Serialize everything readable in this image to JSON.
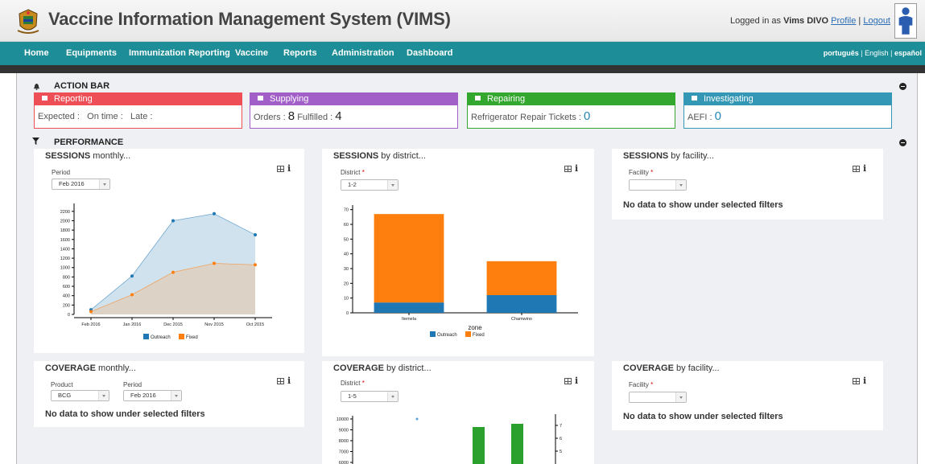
{
  "header": {
    "title": "Vaccine Information Management System (VIMS)",
    "logged_in_prefix": "Logged in as",
    "user_name": "Vims DIVO",
    "profile_link": "Profile",
    "separator": "|",
    "logout_link": "Logout"
  },
  "nav": {
    "items": [
      "Home",
      "Equipments",
      "Immunization Reporting",
      "Vaccine",
      "Reports",
      "Administration",
      "Dashboard"
    ],
    "languages": [
      "português",
      "English",
      "español"
    ],
    "lang_separator": "|"
  },
  "action_bar": {
    "title": "ACTION BAR",
    "cards": [
      {
        "title": "Reporting",
        "color": "#ee4f57",
        "expected_label": "Expected :",
        "on_time_label": "On time :",
        "late_label": "Late :"
      },
      {
        "title": "Supplying",
        "color": "#a25fc8",
        "orders_label": "Orders :",
        "orders_value": "8",
        "fulfilled_label": "Fulfilled :",
        "fulfilled_value": "4"
      },
      {
        "title": "Repairing",
        "color": "#34a72e",
        "label": "Refrigerator Repair Tickets :",
        "value": "0"
      },
      {
        "title": "Investigating",
        "color": "#3397b5",
        "label": "AEFI :",
        "value": "0"
      }
    ]
  },
  "performance": {
    "title": "PERFORMANCE",
    "sessions_monthly": {
      "title_bold": "SESSIONS",
      "title_rest": " monthly...",
      "period_label": "Period",
      "period_value": "Feb 2016"
    },
    "sessions_district": {
      "title_bold": "SESSIONS",
      "title_rest": " by district...",
      "district_label": "District",
      "required_mark": "*",
      "district_value": "1-2",
      "xlabel": "zone"
    },
    "sessions_facility": {
      "title_bold": "SESSIONS",
      "title_rest": " by facility...",
      "facility_label": "Facility",
      "required_mark": "*",
      "no_data": "No data to show under selected filters"
    },
    "coverage_monthly": {
      "title_bold": "COVERAGE",
      "title_rest": " monthly...",
      "product_label": "Product",
      "product_value": "BCG",
      "period_label": "Period",
      "period_value": "Feb 2016",
      "no_data": "No data to show under selected filters"
    },
    "coverage_district": {
      "title_bold": "COVERAGE",
      "title_rest": " by district...",
      "district_label": "District",
      "required_mark": "*",
      "district_value": "1-5"
    },
    "coverage_facility": {
      "title_bold": "COVERAGE",
      "title_rest": " by facility...",
      "facility_label": "Facility",
      "required_mark": "*",
      "no_data": "No data to show under selected filters"
    }
  },
  "chart_data": [
    {
      "type": "area",
      "categories": [
        "Feb 2016",
        "Jan 2016",
        "Dec 2015",
        "Nov 2015",
        "Oct 2015"
      ],
      "series": [
        {
          "name": "Outreach",
          "values": [
            100,
            820,
            2000,
            2150,
            1700
          ],
          "color": "#1f77b4"
        },
        {
          "name": "Fixed",
          "values": [
            60,
            420,
            900,
            1090,
            1060
          ],
          "color": "#ff7f0e"
        }
      ],
      "ylim": [
        0,
        2300
      ],
      "yticks": [
        0,
        200,
        400,
        600,
        800,
        1000,
        1200,
        1400,
        1600,
        1800,
        2000,
        2200
      ],
      "legend": "bottom"
    },
    {
      "type": "bar",
      "stacked": true,
      "categories": [
        "Itemela",
        "Chamwino"
      ],
      "series": [
        {
          "name": "Outreach",
          "values": [
            7,
            12
          ],
          "color": "#1f77b4"
        },
        {
          "name": "Fixed",
          "values": [
            60,
            23
          ],
          "color": "#ff7f0e"
        }
      ],
      "xlabel": "zone",
      "ylim": [
        0,
        72
      ],
      "yticks": [
        0,
        10,
        20,
        30,
        40,
        50,
        60,
        70
      ],
      "legend": "bottom"
    },
    {
      "type": "bar",
      "partial": true,
      "yticks_left": [
        6000,
        7000,
        8000,
        9000,
        10000
      ],
      "yticks_right": [
        5,
        6,
        7
      ],
      "bars_color": "#2ca02c"
    }
  ]
}
